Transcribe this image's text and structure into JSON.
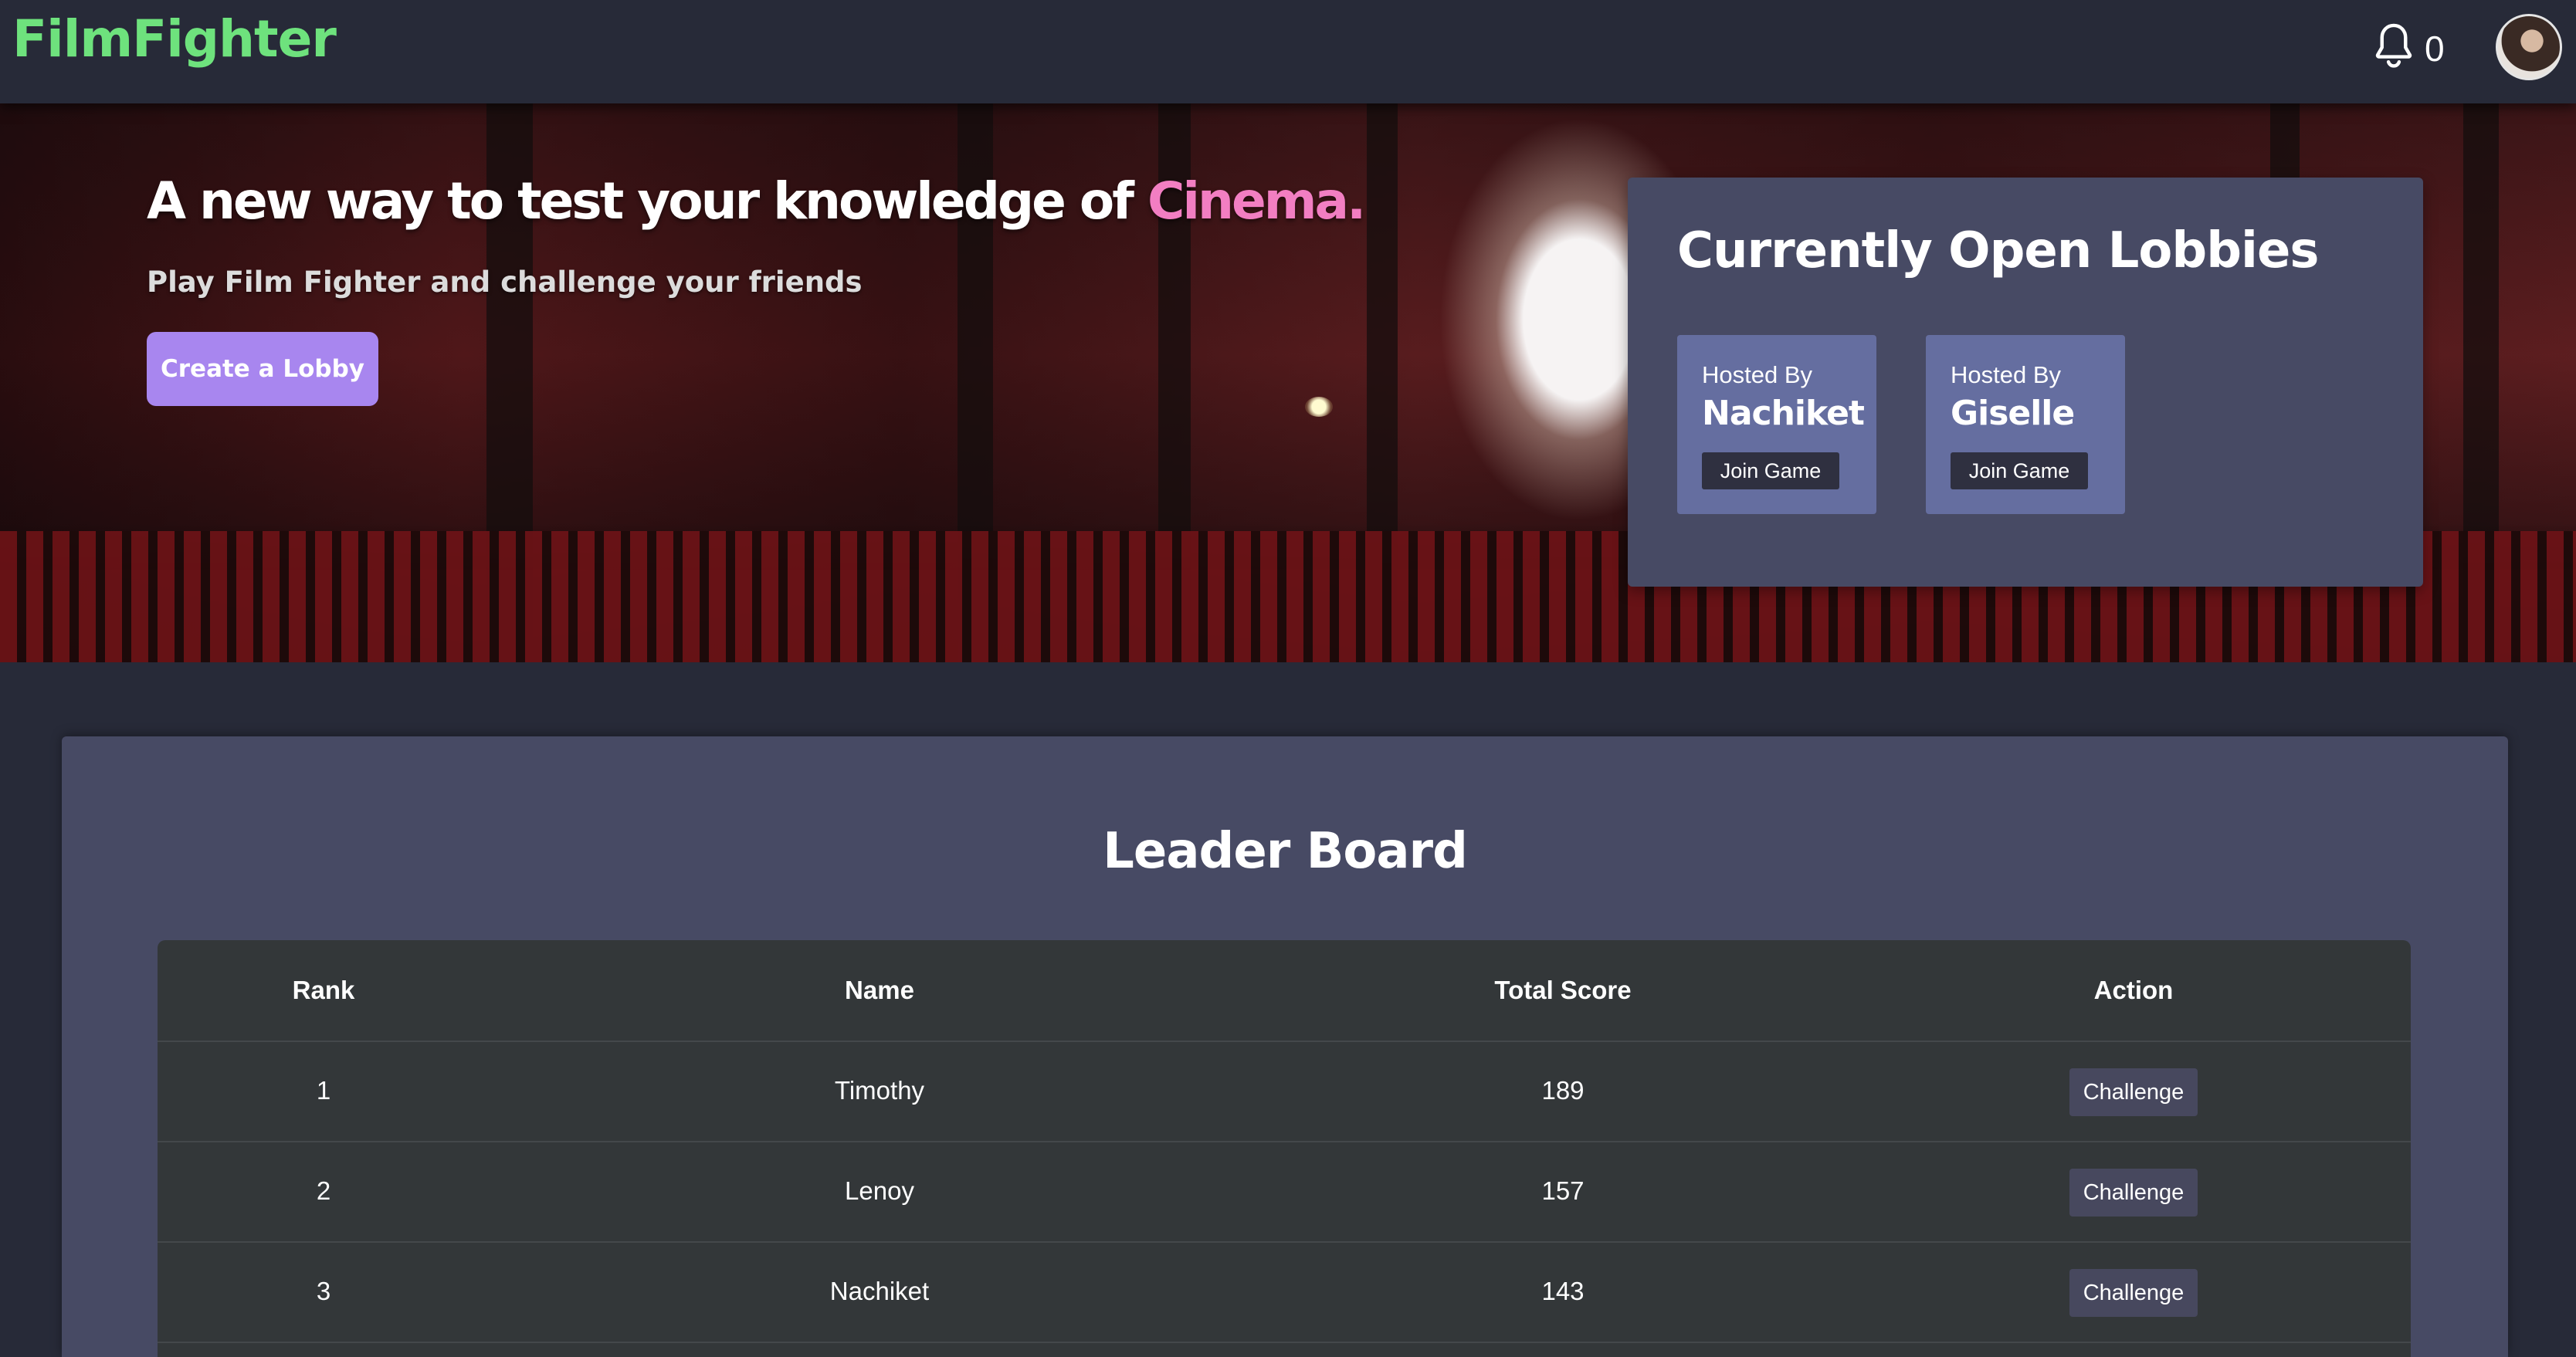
{
  "navbar": {
    "logo": "FilmFighter",
    "notification_count": "0"
  },
  "hero": {
    "title_main": "A new way to test your knowledge of ",
    "title_accent": "Cinema.",
    "subtitle": "Play Film Fighter and challenge your friends",
    "create_lobby_label": "Create a Lobby"
  },
  "lobbies": {
    "title": "Currently Open Lobbies",
    "items": [
      {
        "hosted_label": "Hosted By",
        "host": "Nachiket",
        "join_label": "Join Game"
      },
      {
        "hosted_label": "Hosted By",
        "host": "Giselle",
        "join_label": "Join Game"
      }
    ]
  },
  "leaderboard": {
    "title": "Leader Board",
    "columns": {
      "rank": "Rank",
      "name": "Name",
      "score": "Total Score",
      "action": "Action"
    },
    "rows": [
      {
        "rank": "1",
        "name": "Timothy",
        "score": "189",
        "action_label": "Challenge"
      },
      {
        "rank": "2",
        "name": "Lenoy",
        "score": "157",
        "action_label": "Challenge"
      },
      {
        "rank": "3",
        "name": "Nachiket",
        "score": "143",
        "action_label": "Challenge"
      }
    ]
  },
  "colors": {
    "logo": "#6ee27d",
    "accent_pink": "#f27ec2",
    "create_button": "#a886ef",
    "lobby_card": "#656ea0",
    "panel": "#474a64",
    "background": "#272a38"
  },
  "icons": {
    "notifications": "bell-icon",
    "profile": "avatar"
  }
}
